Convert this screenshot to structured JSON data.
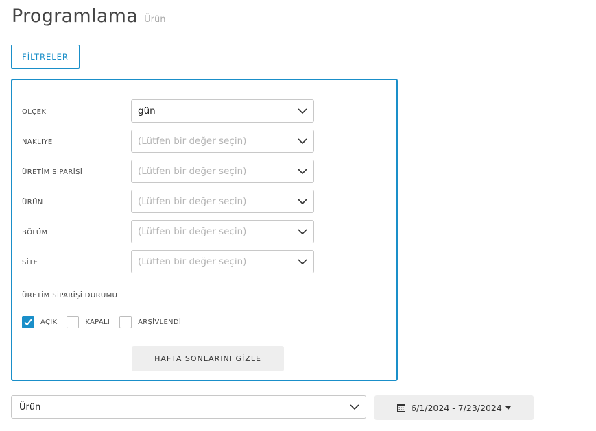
{
  "header": {
    "title": "Programlama",
    "subtitle": "Ürün"
  },
  "filters_button": "FİLTRELER",
  "filters": {
    "fields": [
      {
        "label": "ÖLÇEK",
        "value": "gün",
        "placeholder": ""
      },
      {
        "label": "NAKLİYE",
        "value": "",
        "placeholder": "(Lütfen bir değer seçin)"
      },
      {
        "label": "ÜRETİM SİPARİŞİ",
        "value": "",
        "placeholder": "(Lütfen bir değer seçin)"
      },
      {
        "label": "ÜRÜN",
        "value": "",
        "placeholder": "(Lütfen bir değer seçin)"
      },
      {
        "label": "BÖLÜM",
        "value": "",
        "placeholder": "(Lütfen bir değer seçin)"
      },
      {
        "label": "SİTE",
        "value": "",
        "placeholder": "(Lütfen bir değer seçin)"
      }
    ],
    "status_label": "ÜRETİM SİPARİŞİ DURUMU",
    "statuses": [
      {
        "label": "AÇIK",
        "checked": true
      },
      {
        "label": "KAPALI",
        "checked": false
      },
      {
        "label": "ARŞİVLENDİ",
        "checked": false
      }
    ],
    "hide_weekends_label": "HAFTA SONLARINI GİZLE"
  },
  "bottom": {
    "view_select_value": "Ürün",
    "date_range": "6/1/2024 - 7/23/2024"
  },
  "colors": {
    "accent": "#1a8fc9",
    "button_bg": "#eeeeee"
  },
  "icons": {
    "chevron": "chevron-down-icon",
    "calendar": "calendar-icon",
    "check": "checkmark-icon"
  }
}
